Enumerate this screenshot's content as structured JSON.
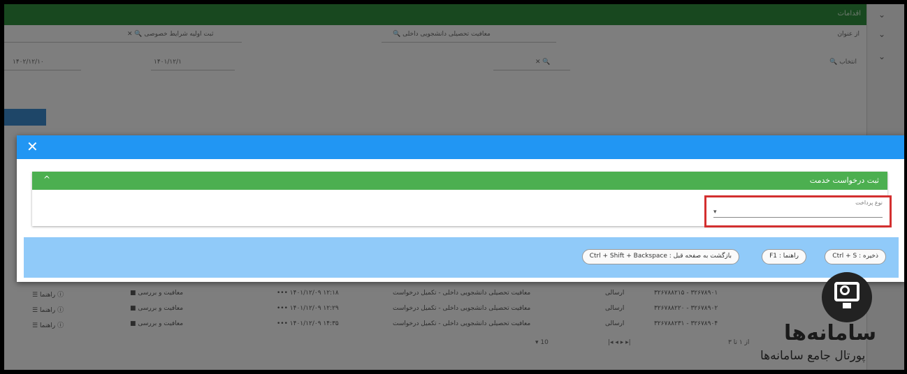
{
  "background": {
    "topbar_title": "اقدامات",
    "sidebar_chevrons": [
      "⌄",
      "⌄",
      "⌄"
    ],
    "filter_row1": {
      "left_field": "✕ 🔍 ثبت اولیه شرایط خصوصی",
      "center_field": "🔍 معافیت تحصیلی دانشجویی داخلی",
      "right_label": "از عنوان"
    },
    "filter_row2": {
      "date1": "۱۴۰۲/۱۲/۱۰",
      "date2": "۱۴۰۱/۱۲/۱",
      "status_icons": "✕ 🔍",
      "right_value": "🔍 انتخاب"
    },
    "table_rows": [
      {
        "actions": "☰ راهنما ⓘ",
        "col2": "■ معافیت و بررسی",
        "col3": "••• ۱۴۰۱/۱۲/۰۹ ۱۲:۱۸",
        "col4": "معافیت تحصیلی دانشجویی داخلی - تکمیل درخواست",
        "col5": "ارسالی",
        "col6": "۳۲۶۷۸۸۲۱۵ - ۳۲۶۷۸۹۰۱"
      },
      {
        "actions": "☰ راهنما ⓘ",
        "col2": "■ معافیت و بررسی",
        "col3": "••• ۱۴۰۱/۱۲/۰۹ ۱۲:۲۹",
        "col4": "معافیت تحصیلی دانشجویی داخلی - تکمیل درخواست",
        "col5": "ارسالی",
        "col6": "۳۲۶۷۸۸۲۲۰ - ۳۲۶۷۸۹۰۲"
      },
      {
        "actions": "☰ راهنما ⓘ",
        "col2": "■ معافیت و بررسی",
        "col3": "••• ۱۴۰۱/۱۲/۰۹ ۱۴:۳۵",
        "col4": "معافیت تحصیلی دانشجویی داخلی - تکمیل درخواست",
        "col5": "ارسالی",
        "col6": "۳۲۶۷۸۸۲۳۱ - ۳۲۶۷۸۹۰۴"
      }
    ],
    "pagination": {
      "page_size": "▾ 10",
      "nav": "|◂  ◂  ▸  ▸|",
      "count": "از ۱ تا ۳"
    }
  },
  "dialog": {
    "close_glyph": "✕",
    "panel_title": "ثبت درخواست خدمت",
    "panel_toggle": "^",
    "field_label": "نوع پرداخت",
    "field_value": "",
    "field_arrow": "▾",
    "chips": [
      {
        "label": "Ctrl + S : ذخیره"
      },
      {
        "label": "F1 : راهنما"
      },
      {
        "label": "Ctrl + Shift + Backspace : بازگشت به صفحه قبل"
      }
    ]
  },
  "watermark": {
    "name": "سامانه‌ها",
    "subtitle": "پورتال جامع سامانه‌ها"
  }
}
